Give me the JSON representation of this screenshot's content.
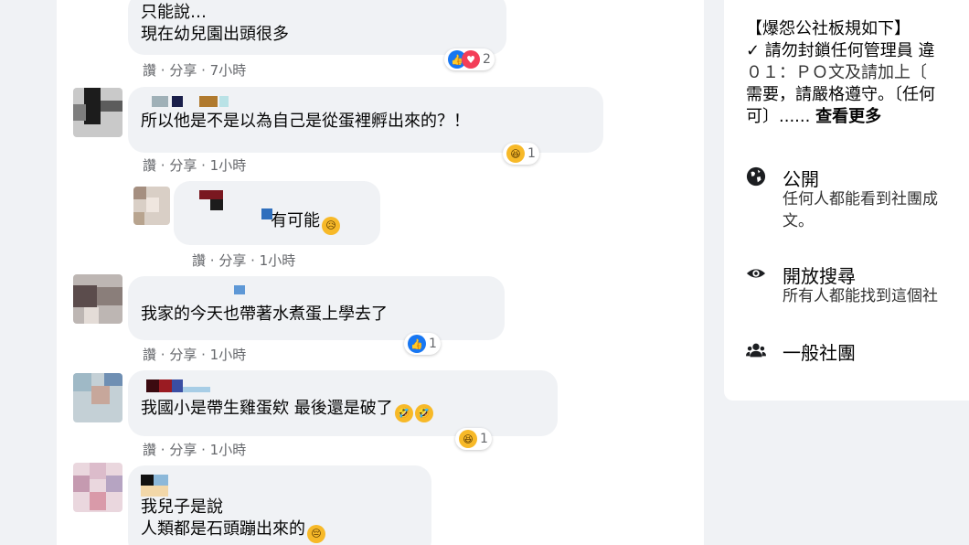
{
  "comments": [
    {
      "lines": [
        "只能說…",
        "現在幼兒園出頭很多"
      ],
      "actions": {
        "like": "讚",
        "share": "分享",
        "time": "7小時"
      },
      "reaction_count": "2"
    },
    {
      "lines": [
        "所以他是不是以為自己是從蛋裡孵出來的？！"
      ],
      "actions": {
        "like": "讚",
        "share": "分享",
        "time": "1小時"
      },
      "reaction_count": "1"
    },
    {
      "lines": [
        "有可能"
      ],
      "actions": {
        "like": "讚",
        "share": "分享",
        "time": "1小時"
      }
    },
    {
      "lines": [
        "我家的今天也帶著水煮蛋上學去了"
      ],
      "actions": {
        "like": "讚",
        "share": "分享",
        "time": "1小時"
      },
      "reaction_count": "1"
    },
    {
      "lines": [
        "我國小是帶生雞蛋欸 最後還是破了"
      ],
      "actions": {
        "like": "讚",
        "share": "分享",
        "time": "1小時"
      },
      "reaction_count": "1"
    },
    {
      "lines": [
        "我兒子是說",
        "人類都是石頭蹦出來的"
      ]
    }
  ],
  "sidebar": {
    "rules_title": "【爆怨公社板規如下】",
    "rules_line1": "✓ 請勿封鎖任何管理員 違",
    "rules_line2": "０１：ＰＯ文及請加上〔",
    "rules_line3": "需要，請嚴格遵守。〔任何",
    "rules_line4": "可〕......",
    "see_more": "查看更多",
    "public_title": "公開",
    "public_desc1": "任何人都能看到社團成",
    "public_desc2": "文。",
    "visible_title": "開放搜尋",
    "visible_desc": "所有人都能找到這個社",
    "type_title": "一般社團"
  },
  "colors": {
    "like": "#1877f2",
    "love": "#f33e58",
    "haha": "#f7b928",
    "secondary_text": "#65676b",
    "bubble": "#f0f2f5"
  },
  "icons": [
    "like-icon",
    "love-icon",
    "haha-icon",
    "globe-icon",
    "eye-icon",
    "group-icon"
  ]
}
